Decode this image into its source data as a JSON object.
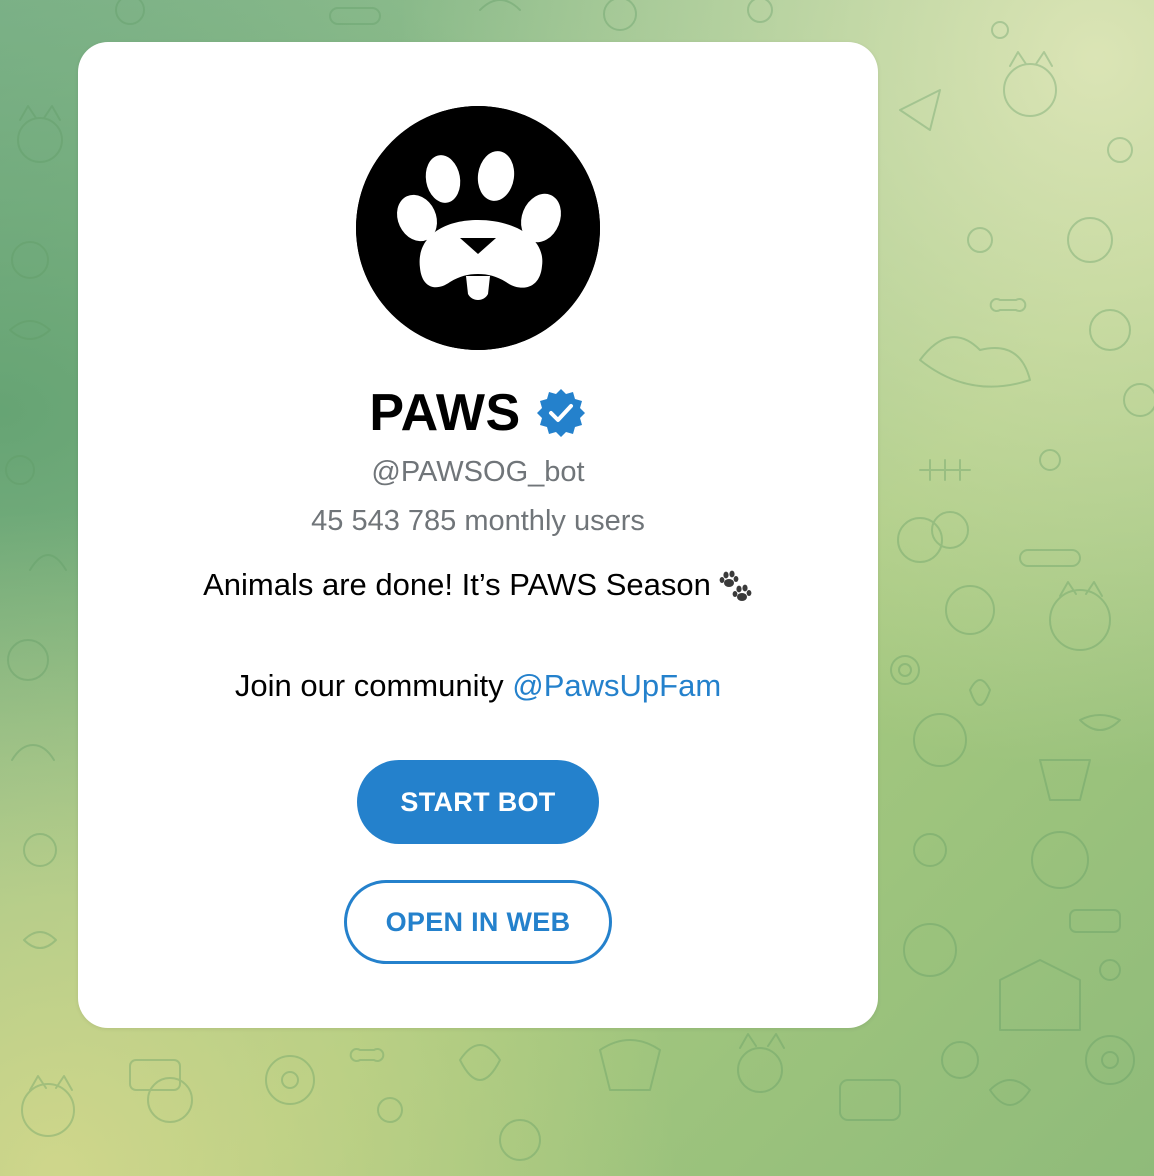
{
  "bot": {
    "name": "PAWS",
    "username": "@PAWSOG_bot",
    "monthly_users": "45 543 785 monthly users",
    "description": "Animals are done! It’s PAWS Season",
    "community_prefix": "Join our community ",
    "community_link": "@PawsUpFam",
    "verified": true
  },
  "buttons": {
    "start": "START BOT",
    "open_web": "OPEN IN WEB"
  },
  "colors": {
    "accent": "#2481cc",
    "muted_text": "#707579",
    "avatar_bg": "#000000"
  },
  "icons": {
    "avatar": "paw-logo-icon",
    "verified": "verified-badge-icon",
    "emoji": "paw-prints-emoji-icon"
  }
}
